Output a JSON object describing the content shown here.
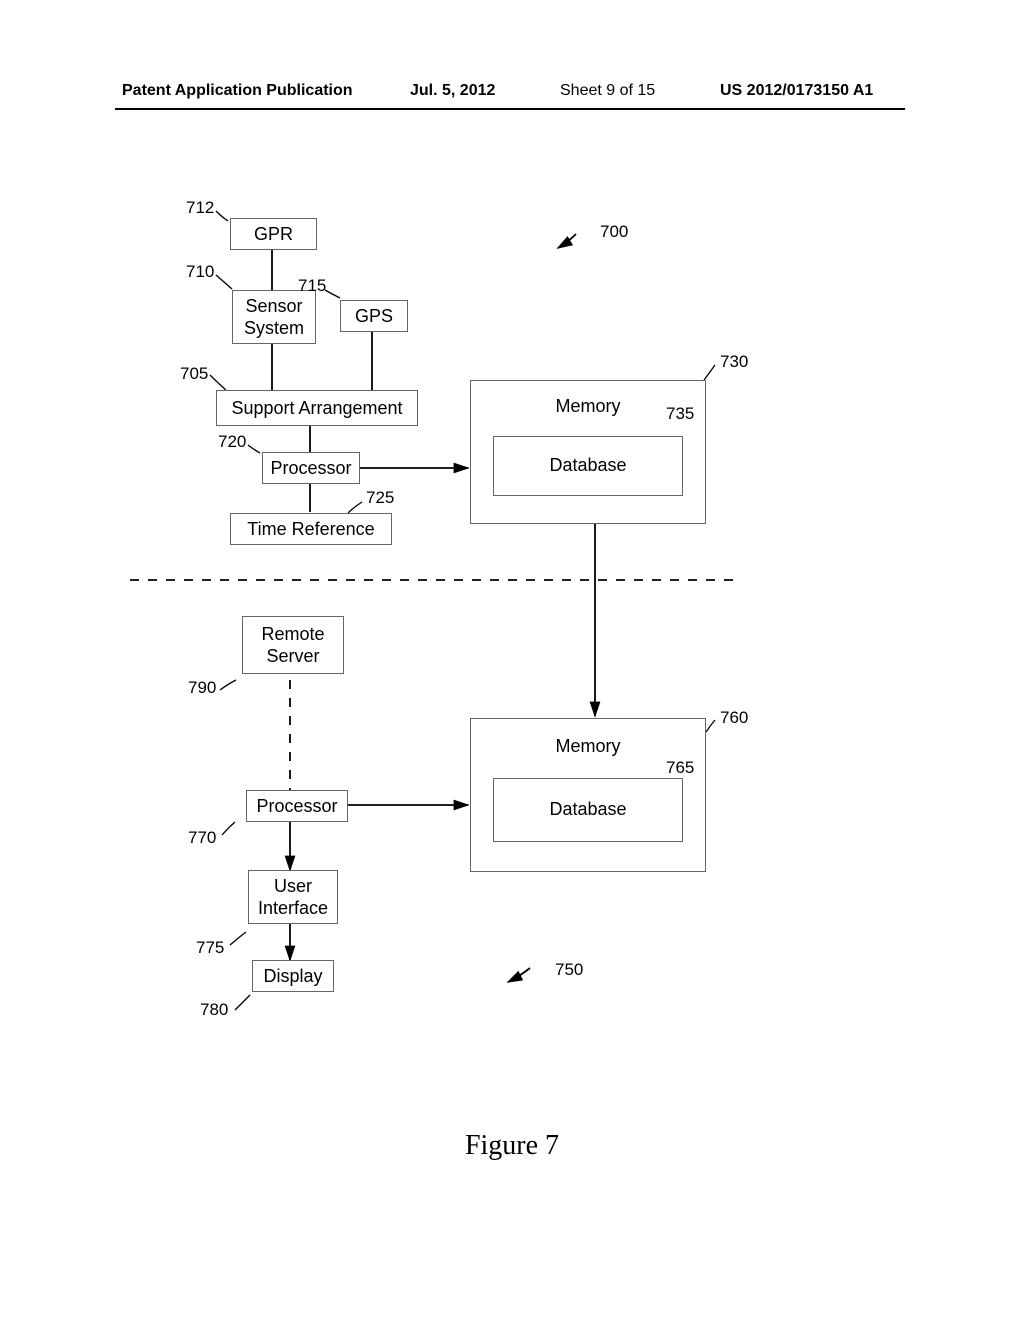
{
  "header": {
    "left": "Patent Application Publication",
    "date": "Jul. 5, 2012",
    "sheet": "Sheet 9 of 15",
    "pubno": "US 2012/0173150 A1"
  },
  "figure_caption": "Figure 7",
  "labels": {
    "l712": "712",
    "l710": "710",
    "l715": "715",
    "l705": "705",
    "l720": "720",
    "l725": "725",
    "l730": "730",
    "l735": "735",
    "l700": "700",
    "l790": "790",
    "l770": "770",
    "l775": "775",
    "l780": "780",
    "l760": "760",
    "l765": "765",
    "l750": "750"
  },
  "boxes": {
    "gpr": "GPR",
    "sensor": "Sensor\nSystem",
    "gps": "GPS",
    "support": "Support Arrangement",
    "processor1": "Processor",
    "timeref": "Time Reference",
    "memory1": "Memory",
    "database1": "Database",
    "remote": "Remote\nServer",
    "processor2": "Processor",
    "memory2": "Memory",
    "database2": "Database",
    "ui": "User\nInterface",
    "display": "Display"
  }
}
